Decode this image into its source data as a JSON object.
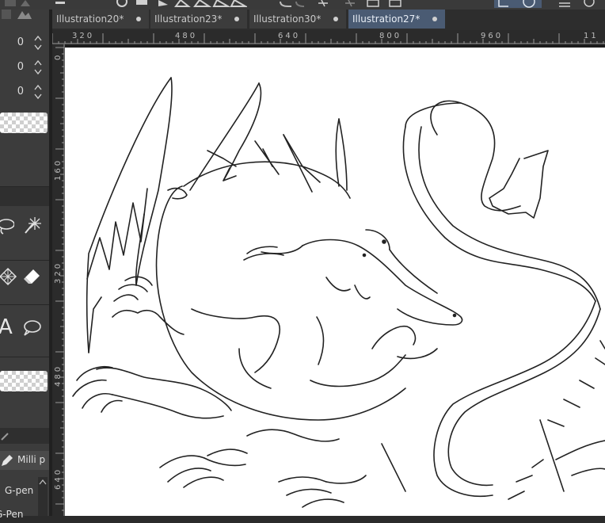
{
  "left_panel": {
    "fields": [
      {
        "value": "0"
      },
      {
        "value": "0"
      },
      {
        "value": "0"
      }
    ],
    "brushes": [
      {
        "label": "Milli p"
      },
      {
        "label": "G-pen"
      },
      {
        "label": "G-Pen"
      }
    ],
    "text_tool_glyph": "A"
  },
  "tabs": [
    {
      "label": "Illustration20*",
      "active": false
    },
    {
      "label": "Illustration23*",
      "active": false
    },
    {
      "label": "Illustration30*",
      "active": false
    },
    {
      "label": "Illustration27*",
      "active": true
    }
  ],
  "ruler": {
    "h_labels": [
      "320",
      "480",
      "640",
      "800",
      "960",
      "11"
    ],
    "v_labels": [
      "0",
      "160",
      "320",
      "480",
      "640"
    ]
  },
  "colors": {
    "tab_active": "#4a5b73",
    "panel": "#3c3c3c",
    "canvas": "#ffffff"
  }
}
